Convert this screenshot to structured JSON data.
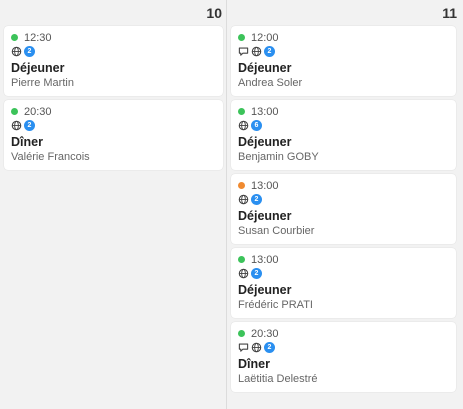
{
  "days": [
    {
      "day": "10",
      "events": [
        {
          "status_color": "#3cc35a",
          "time": "12:30",
          "icons": [
            "globe-icon"
          ],
          "guests": "2",
          "meal": "Déjeuner",
          "name": "Pierre Martin"
        },
        {
          "status_color": "#3cc35a",
          "time": "20:30",
          "icons": [
            "globe-icon"
          ],
          "guests": "2",
          "meal": "Dîner",
          "name": "Valérie Francois"
        }
      ]
    },
    {
      "day": "11",
      "events": [
        {
          "status_color": "#3cc35a",
          "time": "12:00",
          "icons": [
            "chat-icon",
            "globe-icon"
          ],
          "guests": "2",
          "meal": "Déjeuner",
          "name": "Andrea Soler"
        },
        {
          "status_color": "#3cc35a",
          "time": "13:00",
          "icons": [
            "globe-icon"
          ],
          "guests": "6",
          "meal": "Déjeuner",
          "name": "Benjamin GOBY"
        },
        {
          "status_color": "#f08a30",
          "time": "13:00",
          "icons": [
            "globe-icon"
          ],
          "guests": "2",
          "meal": "Déjeuner",
          "name": "Susan Courbier"
        },
        {
          "status_color": "#3cc35a",
          "time": "13:00",
          "icons": [
            "globe-icon"
          ],
          "guests": "2",
          "meal": "Déjeuner",
          "name": "Frédéric PRATI"
        },
        {
          "status_color": "#3cc35a",
          "time": "20:30",
          "icons": [
            "chat-icon",
            "globe-icon"
          ],
          "guests": "2",
          "meal": "Dîner",
          "name": "Laëtitia Delestré"
        }
      ]
    }
  ]
}
